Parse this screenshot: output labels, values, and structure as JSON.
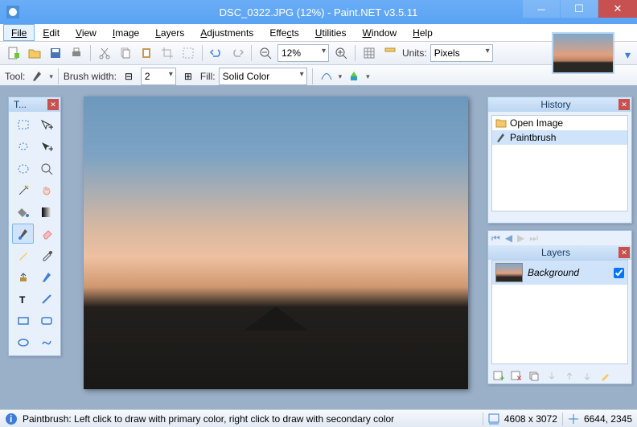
{
  "title": "DSC_0322.JPG (12%) - Paint.NET v3.5.11",
  "menu": {
    "file": "File",
    "edit": "Edit",
    "view": "View",
    "image": "Image",
    "layers": "Layers",
    "adjustments": "Adjustments",
    "effects": "Effects",
    "utilities": "Utilities",
    "window": "Window",
    "help": "Help"
  },
  "toolbar1": {
    "zoom_value": "12%",
    "units_label": "Units:",
    "units_value": "Pixels"
  },
  "toolbar2": {
    "tool_label": "Tool:",
    "brush_label": "Brush width:",
    "brush_value": "2",
    "fill_label": "Fill:",
    "fill_value": "Solid Color"
  },
  "tools_panel": {
    "title": "T..."
  },
  "history_panel": {
    "title": "History",
    "items": [
      "Open Image",
      "Paintbrush"
    ]
  },
  "layers_panel": {
    "title": "Layers",
    "layers": [
      {
        "name": "Background",
        "visible": true
      }
    ]
  },
  "status": {
    "hint": "Paintbrush: Left click to draw with primary color, right click to draw with secondary color",
    "dimensions": "4608 x 3072",
    "cursor": "6644, 2345"
  }
}
